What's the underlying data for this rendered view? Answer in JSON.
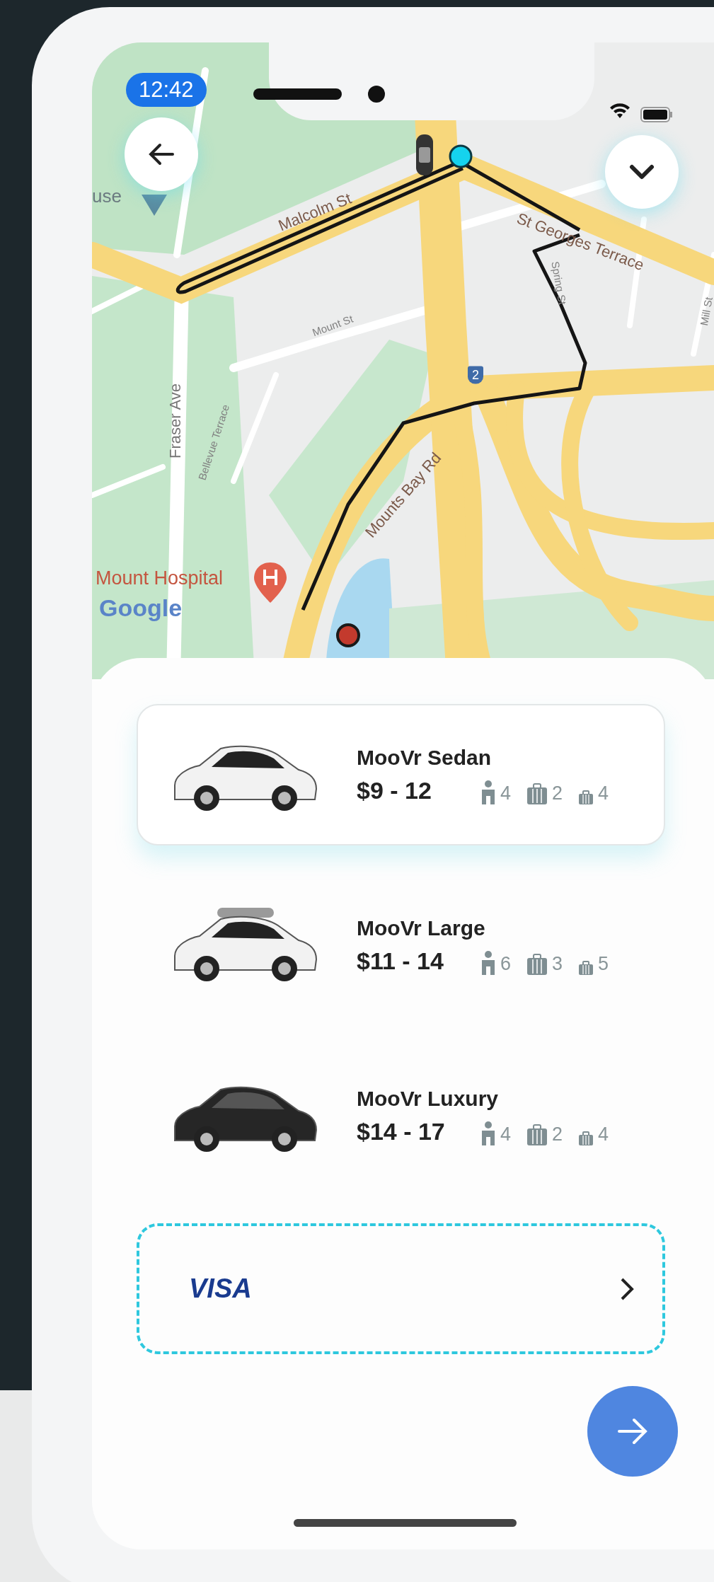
{
  "status_bar": {
    "time": "12:42"
  },
  "map": {
    "labels": [
      {
        "text": "use",
        "kind": "place"
      },
      {
        "text": "Malcolm St",
        "kind": "street"
      },
      {
        "text": "St Georges Terrace",
        "kind": "street"
      },
      {
        "text": "Mount St",
        "kind": "minor"
      },
      {
        "text": "Spring St",
        "kind": "minor"
      },
      {
        "text": "Mill St",
        "kind": "minor"
      },
      {
        "text": "2",
        "kind": "shield"
      },
      {
        "text": "Fraser Ave",
        "kind": "street"
      },
      {
        "text": "Bellevue Terrace",
        "kind": "minor"
      },
      {
        "text": "Mounts Bay Rd",
        "kind": "street"
      },
      {
        "text": "Mount Hospital",
        "kind": "poi"
      },
      {
        "text": "Google",
        "kind": "logo"
      }
    ]
  },
  "rides": [
    {
      "name": "MooVr Sedan",
      "price": "$9 - 12",
      "passengers": "4",
      "bags": "2",
      "small_bags": "4",
      "kind": "sedan",
      "color": "#f2f2f2",
      "selected": true
    },
    {
      "name": "MooVr Large",
      "price": "$11 - 14",
      "passengers": "6",
      "bags": "3",
      "small_bags": "5",
      "kind": "roofbox",
      "color": "#f2f2f2",
      "selected": false
    },
    {
      "name": "MooVr Luxury",
      "price": "$14 - 17",
      "passengers": "4",
      "bags": "2",
      "small_bags": "4",
      "kind": "sedan",
      "color": "#262626",
      "selected": false
    }
  ],
  "payment": {
    "brand": "VISA"
  }
}
